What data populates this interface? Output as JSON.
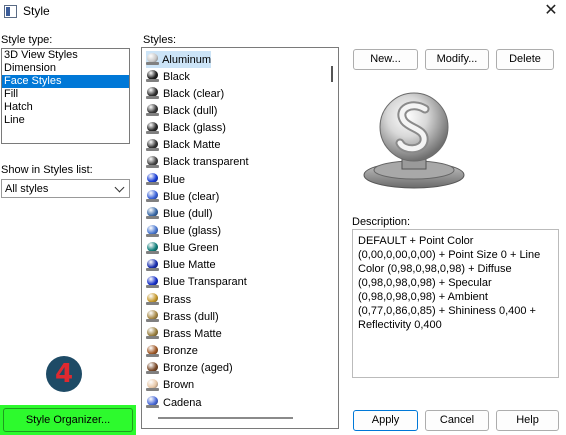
{
  "window": {
    "title": "Style",
    "close_glyph": "✕"
  },
  "style_type": {
    "label": "Style type:",
    "items": [
      "3D View Styles",
      "Dimension",
      "Face Styles",
      "Fill",
      "Hatch",
      "Line"
    ],
    "selected": "Face Styles"
  },
  "show_in_list": {
    "label": "Show in Styles list:",
    "value": "All styles"
  },
  "styles": {
    "label": "Styles:",
    "items": [
      {
        "name": "Aluminum",
        "color": "#c8c8c8",
        "icon": "material-ball-icon"
      },
      {
        "name": "Black",
        "color": "#202020",
        "icon": "material-ball-icon"
      },
      {
        "name": "Black (clear)",
        "color": "#303030",
        "icon": "material-ball-icon"
      },
      {
        "name": "Black (dull)",
        "color": "#3a3a3a",
        "icon": "material-ball-icon"
      },
      {
        "name": "Black (glass)",
        "color": "#282828",
        "icon": "material-ball-icon"
      },
      {
        "name": "Black Matte",
        "color": "#333333",
        "icon": "material-ball-icon"
      },
      {
        "name": "Black transparent",
        "color": "#444444",
        "icon": "material-ball-icon"
      },
      {
        "name": "Blue",
        "color": "#1a3fd6",
        "icon": "material-ball-icon"
      },
      {
        "name": "Blue (clear)",
        "color": "#3a62d8",
        "icon": "material-ball-icon"
      },
      {
        "name": "Blue (dull)",
        "color": "#3a6aa8",
        "icon": "material-ball-icon"
      },
      {
        "name": "Blue (glass)",
        "color": "#4a78d0",
        "icon": "material-ball-icon"
      },
      {
        "name": "Blue Green",
        "color": "#12807c",
        "icon": "material-ball-icon"
      },
      {
        "name": "Blue Matte",
        "color": "#1a2fb0",
        "icon": "material-ball-icon"
      },
      {
        "name": "Blue Transparant",
        "color": "#1730c8",
        "icon": "material-ball-icon"
      },
      {
        "name": "Brass",
        "color": "#c79a2e",
        "icon": "material-ball-icon"
      },
      {
        "name": "Brass (dull)",
        "color": "#a88a48",
        "icon": "material-ball-icon"
      },
      {
        "name": "Brass Matte",
        "color": "#9a8040",
        "icon": "material-ball-icon"
      },
      {
        "name": "Bronze",
        "color": "#a05a28",
        "icon": "material-ball-icon"
      },
      {
        "name": "Bronze (aged)",
        "color": "#7a4a2a",
        "icon": "material-ball-icon"
      },
      {
        "name": "Brown",
        "color": "#e8c8a8",
        "icon": "material-ball-icon"
      },
      {
        "name": "Cadena",
        "color": "#4a6ad8",
        "icon": "material-ball-icon"
      }
    ],
    "selected": "Aluminum"
  },
  "buttons": {
    "new": "New...",
    "modify": "Modify...",
    "delete": "Delete",
    "apply": "Apply",
    "cancel": "Cancel",
    "help": "Help",
    "style_organizer": "Style Organizer..."
  },
  "description": {
    "label": "Description:",
    "text": "DEFAULT + Point Color (0,00,0,00,0,00) + Point Size 0 + Line Color (0,98,0,98,0,98) + Diffuse (0,98,0,98,0,98) + Specular (0,98,0,98,0,98) + Ambient (0,77,0,86,0,85) + Shininess 0,400 + Reflectivity 0,400"
  },
  "annotation": {
    "step": "4"
  },
  "colors": {
    "accent": "#0078d7",
    "highlight": "#2dfa2d",
    "badge_bg": "#1e4b66",
    "badge_fg": "#e0292f"
  }
}
